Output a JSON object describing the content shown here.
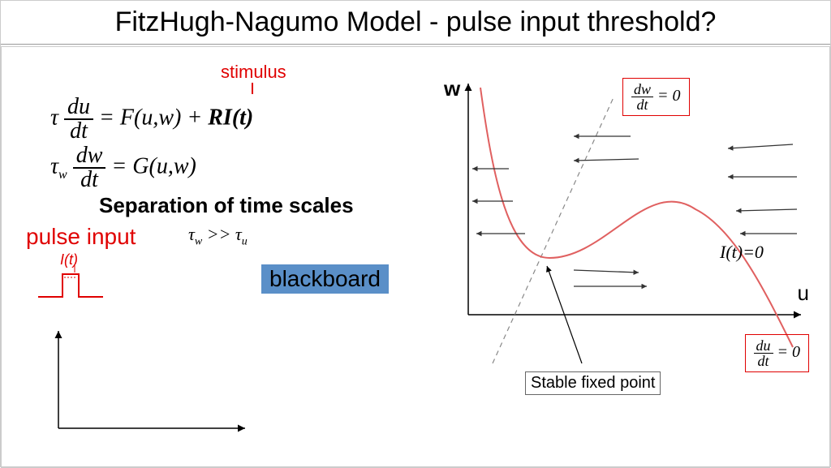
{
  "title": "FitzHugh-Nagumo Model  - pulse input threshold?",
  "stimulus_label": "stimulus",
  "equations": {
    "eq1_tau": "τ",
    "eq1_num": "du",
    "eq1_den": "dt",
    "eq1_rhs_F": "= F(u,w) +",
    "eq1_rhs_RI": "RI(t)",
    "eq2_tau": "τ",
    "eq2_tau_sub": "w",
    "eq2_num": "dw",
    "eq2_den": "dt",
    "eq2_rhs": "= G(u,w)"
  },
  "separation_heading": "Separation of time scales",
  "pulse_input_label": "pulse input",
  "tau_relation_tw": "τ",
  "tau_relation_w": "w",
  "tau_relation_gg": " >> ",
  "tau_relation_tu": "τ",
  "tau_relation_u": "u",
  "it_label": "I(t)",
  "blackboard_label": "blackboard",
  "phase": {
    "w_axis": "w",
    "u_axis": "u",
    "dwdt_num": "dw",
    "dwdt_den": "dt",
    "dwdt_eq": " = 0",
    "dudt_num": "du",
    "dudt_den": "dt",
    "dudt_eq": " = 0",
    "it0": "I(t)=0",
    "stable": "Stable fixed point"
  },
  "chart_data": {
    "type": "diagram",
    "description": "Phase plane of FitzHugh-Nagumo model at I(t)=0",
    "axes": {
      "x": "u",
      "y": "w"
    },
    "nullclines": {
      "u_nullcline": "cubic curve (red) where du/dt = 0",
      "w_nullcline": "dashed straight line where dw/dt = 0"
    },
    "fixed_point": {
      "type": "stable",
      "location": "intersection of nullclines in left valley"
    },
    "vector_field": "horizontal arrows pointing toward u-nullcline (leftward on right side, rightward inside valley)"
  }
}
